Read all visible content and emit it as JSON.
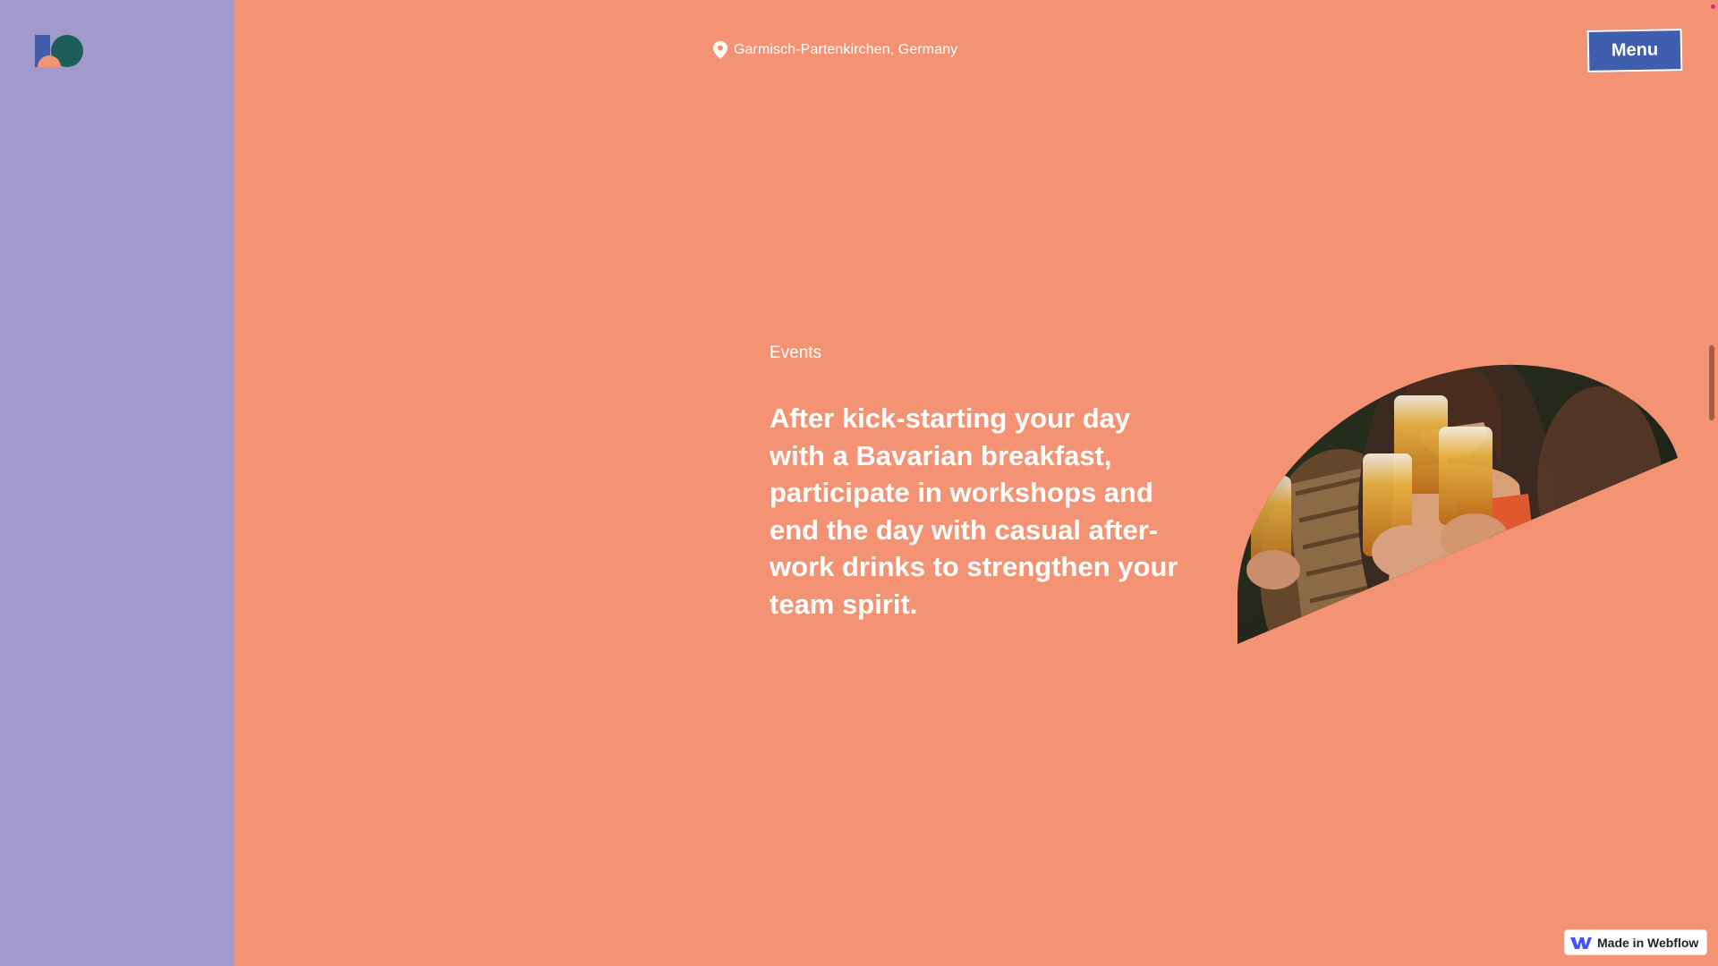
{
  "header": {
    "location": "Garmisch-Partenkirchen, Germany",
    "menu_label": "Menu"
  },
  "section": {
    "label": "Events",
    "headline": "After kick-starting your day with a Bavarian breakfast, participate in workshops and end the day with casual after-work drinks to strengthen your team spirit."
  },
  "badge": {
    "label": "Made in Webflow"
  },
  "icons": {
    "logo": "brand-logo-icon",
    "location": "map-pin-icon",
    "webflow": "webflow-w-icon"
  },
  "colors": {
    "page_background": "#F39373",
    "sidebar": "#A29ACB",
    "menu_button": "#3F5FAE",
    "text": "#FFFFFF"
  }
}
